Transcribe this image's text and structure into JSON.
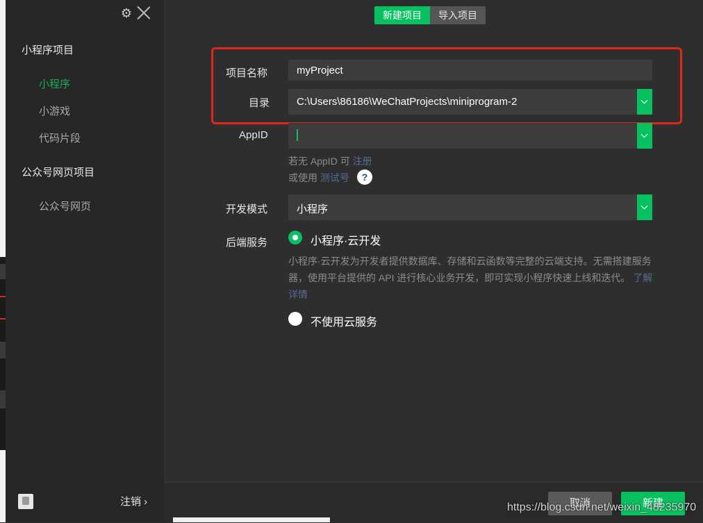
{
  "sidebar": {
    "section_miniprogram": "小程序项目",
    "items_miniprogram": [
      "小程序",
      "小游戏",
      "代码片段"
    ],
    "section_official": "公众号网页项目",
    "items_official": [
      "公众号网页"
    ],
    "logout_label": "注销 ›",
    "settings_icon": "⚙"
  },
  "tabs": {
    "new_project": "新建项目",
    "import_project": "导入项目"
  },
  "form": {
    "name_label": "项目名称",
    "name_value": "myProject",
    "dir_label": "目录",
    "dir_value": "C:\\Users\\86186\\WeChatProjects\\miniprogram-2",
    "appid_label": "AppID",
    "appid_hint_prefix": "若无 AppID 可",
    "appid_hint_link": "注册",
    "appid_alt_prefix": "或使用",
    "appid_alt_link": "测试号",
    "help_icon": "?",
    "mode_label": "开发模式",
    "mode_value": "小程序",
    "backend_label": "后端服务",
    "backend_option_cloud": "小程序·云开发",
    "backend_cloud_desc": "小程序·云开发为开发者提供数据库、存储和云函数等完整的云端支持。无需搭建服务器，使用平台提供的 API 进行核心业务开发，即可实现小程序快速上线和迭代。",
    "backend_cloud_link": "了解详情",
    "backend_option_none": "不使用云服务"
  },
  "footer": {
    "cancel_label": "取消",
    "create_label": "新建"
  },
  "watermark": "https://blog.csdn.net/weixin_48235970",
  "colors": {
    "accent": "#07c160",
    "link": "#576b95",
    "highlight_box": "#e1251b"
  }
}
